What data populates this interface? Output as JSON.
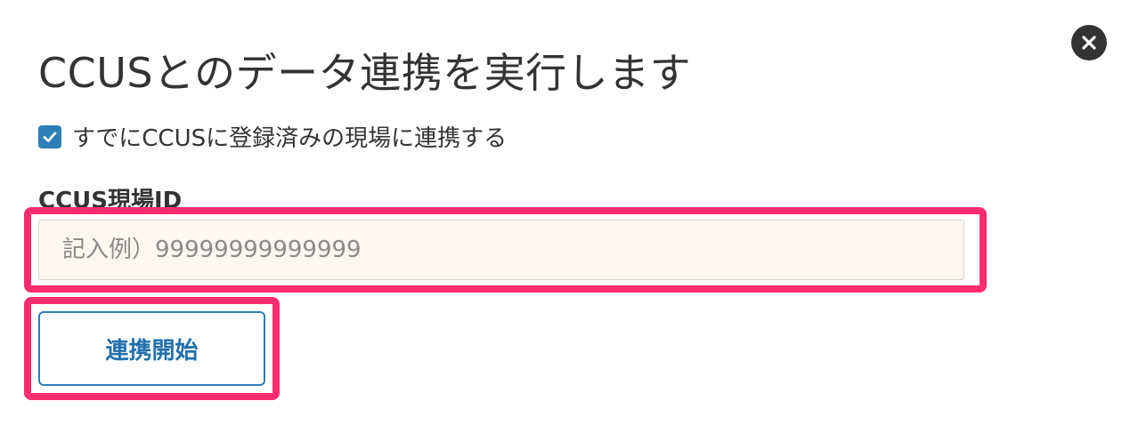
{
  "dialog": {
    "title": "CCUSとのデータ連携を実行します",
    "close_icon": "close-icon"
  },
  "link_option": {
    "checked": true,
    "label": "すでにCCUSに登録済みの現場に連携する"
  },
  "site_id_field": {
    "label": "CCUS現場ID",
    "value": "",
    "placeholder": "記入例）99999999999999"
  },
  "start_button": {
    "label": "連携開始"
  },
  "colors": {
    "accent": "#2d7fb8",
    "highlight": "#ff2d6e",
    "input_bg": "#fcf7f0",
    "text": "#333333"
  }
}
